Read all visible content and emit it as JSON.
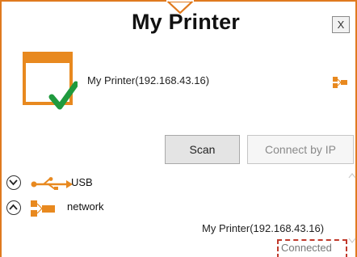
{
  "window": {
    "title": "My Printer",
    "close_label": "X",
    "accent_color": "#e07a1f"
  },
  "device": {
    "name": "My Printer(192.168.43.16)",
    "icon": "printer-icon",
    "status_icon": "checkmark-icon"
  },
  "actions": {
    "scan_label": "Scan",
    "connect_ip_label": "Connect by IP"
  },
  "connections": [
    {
      "toggle": "expand",
      "icon": "usb-icon",
      "label": "USB"
    },
    {
      "toggle": "collapse",
      "icon": "network-icon",
      "label": "network"
    }
  ],
  "network_devices": [
    {
      "name": "My Printer(192.168.43.16)",
      "status": "Connected",
      "status_highlight": "#c0392b"
    }
  ]
}
